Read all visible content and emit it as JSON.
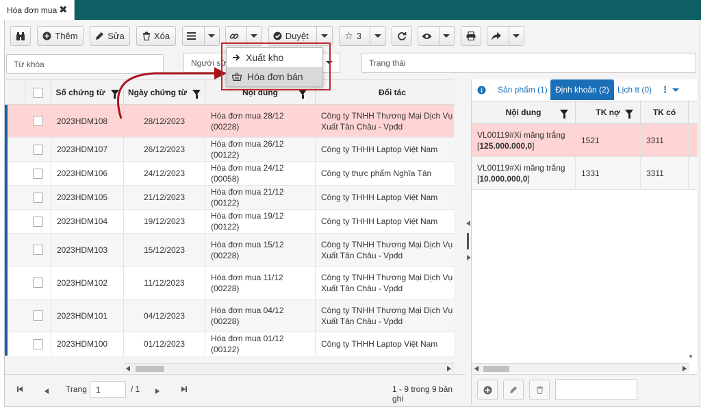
{
  "tab": {
    "title": "Hóa đơn mua",
    "close": "✖"
  },
  "toolbar": {
    "add_label": "Thêm",
    "edit_label": "Sửa",
    "delete_label": "Xóa",
    "approve_label": "Duyệt",
    "star_count": "3"
  },
  "filters": {
    "keyword_placeholder": "Từ khóa",
    "user_placeholder": "Người sử",
    "status_placeholder": "Trạng thái"
  },
  "menu": {
    "items": [
      {
        "label": "Xuất kho",
        "icon": "arrow-right-icon"
      },
      {
        "label": "Hóa đơn bán",
        "icon": "basket-icon"
      }
    ]
  },
  "grid": {
    "columns": [
      "Số chứng từ",
      "Ngày chứng từ",
      "Nội dung",
      "Đối tác"
    ],
    "rows": [
      {
        "so": "2023HDM108",
        "ngay": "28/12/2023",
        "noidung": "Hóa đơn mua 28/12 (00228)",
        "doitac": "Công ty TNHH Thương Mại Dịch Vụ & Sản Xuất Tân Châu - Vpđd"
      },
      {
        "so": "2023HDM107",
        "ngay": "26/12/2023",
        "noidung": "Hóa đơn mua 26/12 (00122)",
        "doitac": "Công ty THHH Laptop Việt Nam"
      },
      {
        "so": "2023HDM106",
        "ngay": "24/12/2023",
        "noidung": "Hóa đơn mua 24/12 (00058)",
        "doitac": "Công ty thực phẩm Nghĩa Tân"
      },
      {
        "so": "2023HDM105",
        "ngay": "21/12/2023",
        "noidung": "Hóa đơn mua 21/12 (00122)",
        "doitac": "Công ty THHH Laptop Việt Nam"
      },
      {
        "so": "2023HDM104",
        "ngay": "19/12/2023",
        "noidung": "Hóa đơn mua 19/12 (00122)",
        "doitac": "Công ty THHH Laptop Việt Nam"
      },
      {
        "so": "2023HDM103",
        "ngay": "15/12/2023",
        "noidung": "Hóa đơn mua 15/12 (00228)",
        "doitac": "Công ty TNHH Thương Mại Dịch Vụ & Sản Xuất Tân Châu - Vpđd"
      },
      {
        "so": "2023HDM102",
        "ngay": "11/12/2023",
        "noidung": "Hóa đơn mua 11/12 (00228)",
        "doitac": "Công ty TNHH Thương Mại Dịch Vụ & Sản Xuất Tân Châu - Vpđd"
      },
      {
        "so": "2023HDM101",
        "ngay": "04/12/2023",
        "noidung": "Hóa đơn mua 04/12 (00228)",
        "doitac": "Công ty TNHH Thương Mại Dịch Vụ & Sản Xuất Tân Châu - Vpđd"
      },
      {
        "so": "2023HDM100",
        "ngay": "01/12/2023",
        "noidung": "Hóa đơn mua 01/12 (00122)",
        "doitac": "Công ty THHH Laptop Việt Nam"
      }
    ]
  },
  "pager": {
    "page_label": "Trang",
    "page_value": "1",
    "page_total": "/ 1",
    "summary": "1 - 9 trong 9 bản ghi"
  },
  "right": {
    "tabs": [
      "Sản phẩm (1)",
      "Định khoản (2)",
      "Lịch tt (0)"
    ],
    "columns": [
      "Nội dung",
      "TK nợ",
      "TK có"
    ],
    "rows": [
      {
        "line1": "VL00119#Xi măng trắng",
        "amount": "125.000.000,0",
        "tkno": "1521",
        "tkco": "3311"
      },
      {
        "line1": "VL00119#Xi măng trắng",
        "amount": "10.000.000,0",
        "tkno": "1331",
        "tkco": "3311"
      }
    ]
  },
  "colors": {
    "teal": "#0e5f63",
    "accent": "#1b6fb6",
    "selected_row": "#ffd4d4",
    "highlight_box": "#c0272d"
  }
}
